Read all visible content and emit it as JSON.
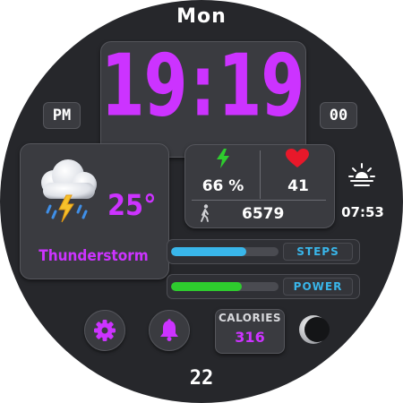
{
  "day_of_week": "Mon",
  "time": {
    "hours": "19",
    "separator": ":",
    "minutes": "19",
    "ampm": "PM",
    "seconds": "00"
  },
  "weather": {
    "icon": "thunderstorm-cloud-icon",
    "temperature": "25°",
    "condition": "Thunderstorm"
  },
  "stats": {
    "battery": {
      "icon": "lightning-bolt-icon",
      "value": "66 %"
    },
    "heart_rate": {
      "icon": "heart-icon",
      "value": "41"
    },
    "steps": {
      "icon": "walking-person-icon",
      "value": "6579"
    }
  },
  "sunrise": {
    "icon": "sunrise-icon",
    "time": "07:53"
  },
  "progress_bars": [
    {
      "label": "STEPS",
      "fraction": 0.7,
      "color": "#39b6ea"
    },
    {
      "label": "POWER",
      "fraction": 0.66,
      "color": "#2ecc2e"
    }
  ],
  "buttons": {
    "settings_icon": "gear-icon",
    "alarm_icon": "bell-icon",
    "moon_icon": "moon-phase-icon"
  },
  "calories": {
    "label": "CALORIES",
    "value": "316"
  },
  "date": "22",
  "colors": {
    "accent": "#cc33ff",
    "background": "#26272b",
    "steps_bar": "#39b6ea",
    "power_bar": "#2ecc2e",
    "label_text": "#39b6ea"
  }
}
